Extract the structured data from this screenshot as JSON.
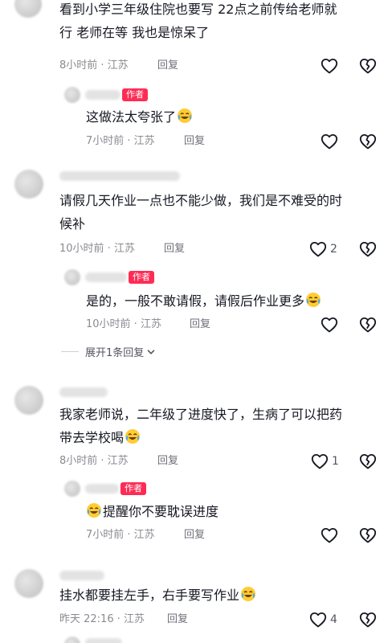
{
  "comments": [
    {
      "text": "看到小学三年级住院也要写  22点之前传给老师就行 老师在等  我也是惊呆了",
      "time_location": "8小时前 · 江苏",
      "reply_label": "回复",
      "like_count": "",
      "replies": [
        {
          "author_tag": "作者",
          "text": "这做法太夸张了",
          "emoji": "crying-laughing-emoji",
          "time_location": "7小时前 · 江苏",
          "reply_label": "回复"
        }
      ]
    },
    {
      "text": "请假几天作业一点也不能少做，我们是不难受的时候补",
      "time_location": "10小时前 · 江苏",
      "reply_label": "回复",
      "like_count": "2",
      "replies": [
        {
          "author_tag": "作者",
          "text": "是的，一般不敢请假，请假后作业更多",
          "emoji": "crying-laughing-emoji",
          "time_location": "10小时前 · 江苏",
          "reply_label": "回复"
        }
      ],
      "expand_label": "展开1条回复"
    },
    {
      "text": "我家老师说，二年级了进度快了，生病了可以把药带去学校喝",
      "time_location": "8小时前 · 江苏",
      "reply_label": "回复",
      "like_count": "1",
      "replies": [
        {
          "author_tag": "作者",
          "text": "提醒你不要耽误进度",
          "emoji": "crying-laughing-emoji",
          "time_location": "7小时前 · 江苏",
          "reply_label": "回复"
        }
      ]
    },
    {
      "text": "挂水都要挂左手，右手要写作业",
      "time_location": "昨天 22:16 · 江苏",
      "reply_label": "回复",
      "like_count": "4"
    }
  ],
  "colors": {
    "author_tag_bg": "#fe2c55",
    "meta_text": "#8a8b91",
    "icon_stroke": "#161823"
  }
}
